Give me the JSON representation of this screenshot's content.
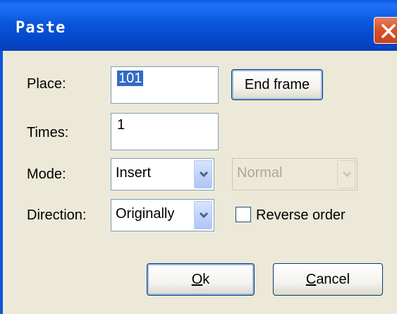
{
  "window": {
    "title": "Paste",
    "close_icon": "close-icon"
  },
  "form": {
    "place_label": "Place:",
    "place_value": "101",
    "end_frame_label": "End frame",
    "times_label": "Times:",
    "times_value": "1",
    "mode_label": "Mode:",
    "mode_value": "Insert",
    "blend_value": "Normal",
    "direction_label": "Direction:",
    "direction_value": "Originally",
    "reverse_label": "Reverse order",
    "reverse_checked": false
  },
  "buttons": {
    "ok_mnemonic": "O",
    "ok_rest": "k",
    "cancel_mnemonic": "C",
    "cancel_rest": "ancel"
  },
  "colors": {
    "titlebar": "#0b56dc",
    "dialog_bg": "#ece9d8",
    "selection": "#316ac5",
    "close_button": "#d9542b"
  }
}
